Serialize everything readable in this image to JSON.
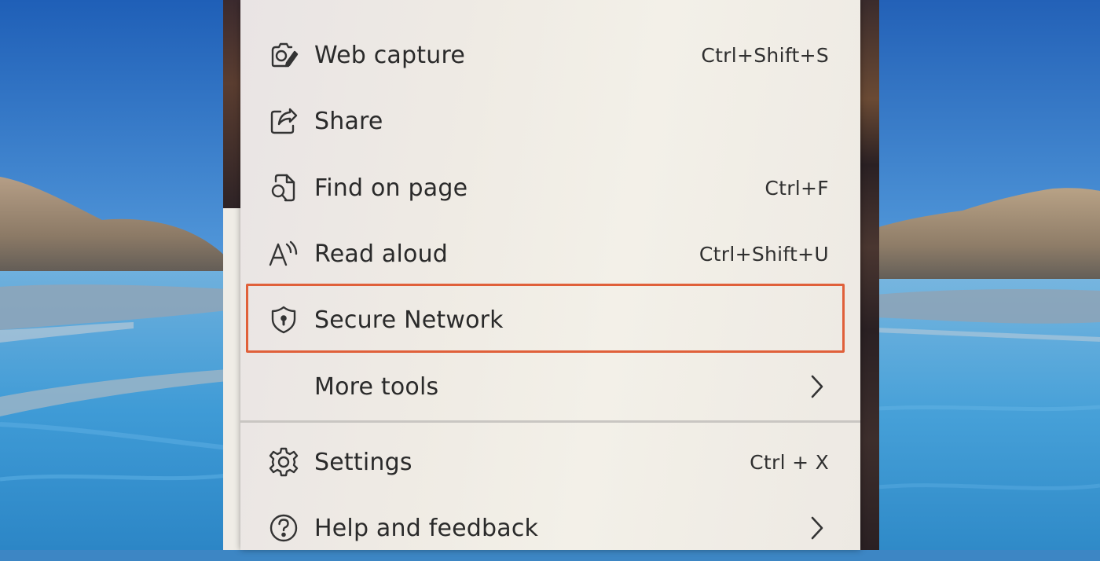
{
  "menu": {
    "items": [
      {
        "label": "Web capture",
        "shortcut": "Ctrl+Shift+S",
        "icon": "web-capture-icon"
      },
      {
        "label": "Share",
        "shortcut": "",
        "icon": "share-icon"
      },
      {
        "label": "Find on page",
        "shortcut": "Ctrl+F",
        "icon": "find-on-page-icon"
      },
      {
        "label": "Read aloud",
        "shortcut": "Ctrl+Shift+U",
        "icon": "read-aloud-icon"
      },
      {
        "label": "Secure Network",
        "shortcut": "",
        "icon": "shield-keyhole-icon"
      },
      {
        "label": "More tools",
        "shortcut": "",
        "icon": "",
        "submenu": true
      },
      {
        "label": "Settings",
        "shortcut": "Ctrl + X",
        "icon": "gear-icon"
      },
      {
        "label": "Help and feedback",
        "shortcut": "",
        "icon": "question-circle-icon",
        "submenu": true
      }
    ],
    "highlighted_item": "Secure Network",
    "highlight_color": "#e0603a"
  }
}
